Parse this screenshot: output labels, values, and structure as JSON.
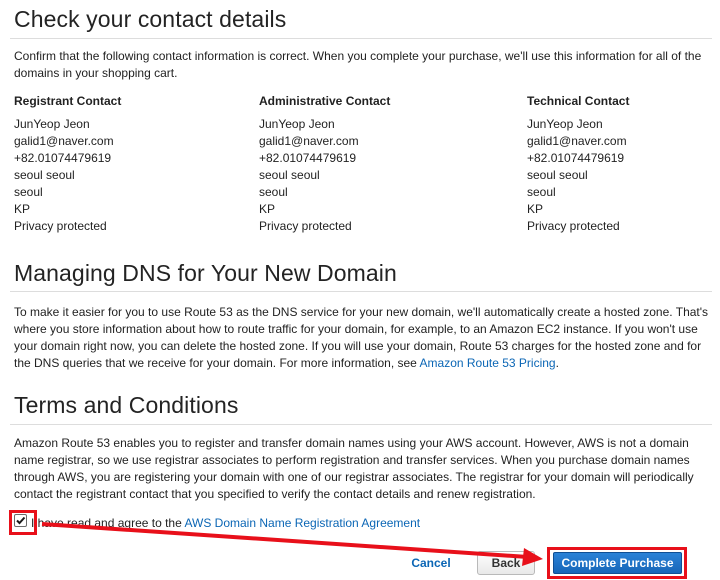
{
  "contact": {
    "title": "Check your contact details",
    "intro": "Confirm that the following contact information is correct. When you complete your purchase, we'll use this information for all of the domains in your shopping cart.",
    "columns": [
      {
        "heading": "Registrant Contact",
        "lines": [
          "JunYeop Jeon",
          "galid1@naver.com",
          "+82.01074479619",
          "seoul seoul",
          "seoul",
          "KP",
          "Privacy protected"
        ]
      },
      {
        "heading": "Administrative Contact",
        "lines": [
          "JunYeop Jeon",
          "galid1@naver.com",
          "+82.01074479619",
          "seoul seoul",
          "seoul",
          "KP",
          "Privacy protected"
        ]
      },
      {
        "heading": "Technical Contact",
        "lines": [
          "JunYeop Jeon",
          "galid1@naver.com",
          "+82.01074479619",
          "seoul seoul",
          "seoul",
          "KP",
          "Privacy protected"
        ]
      }
    ]
  },
  "dns": {
    "title": "Managing DNS for Your New Domain",
    "body": "To make it easier for you to use Route 53 as the DNS service for your new domain, we'll automatically create a hosted zone. That's where you store information about how to route traffic for your domain, for example, to an Amazon EC2 instance. If you won't use your domain right now, you can delete the hosted zone. If you will use your domain, Route 53 charges for the hosted zone and for the DNS queries that we receive for your domain. For more information, see",
    "link": "Amazon Route 53 Pricing",
    "after_link": "."
  },
  "terms": {
    "title": "Terms and Conditions",
    "body": "Amazon Route 53 enables you to register and transfer domain names using your AWS account. However, AWS is not a domain name registrar, so we use registrar associates to perform registration and transfer services. When you purchase domain names through AWS, you are registering your domain with one of our registrar associates. The registrar for your domain will periodically contact the registrant contact that you specified to verify the contact details and renew registration.",
    "agree_text": "I have read and agree to the",
    "agree_link": "AWS Domain Name Registration Agreement",
    "agree_checked": true
  },
  "actions": {
    "cancel": "Cancel",
    "back": "Back",
    "complete": "Complete Purchase"
  },
  "colors": {
    "annotation": "#e8101a",
    "link": "#0b66b5",
    "primary": "#1f74c8"
  }
}
